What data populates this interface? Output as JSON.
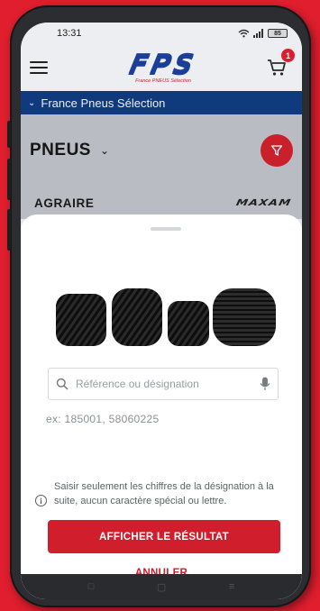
{
  "status_bar": {
    "time": "13:31",
    "battery": "85"
  },
  "header": {
    "logo_text": "FPS",
    "logo_subtitle": "France PNEUS Sélection",
    "cart_count": "1"
  },
  "breadcrumb": {
    "label": "France Pneus Sélection"
  },
  "section": {
    "title": "PNEUS"
  },
  "brand_row": {
    "category": "AGRAIRE",
    "brand_logo": "MAXAM"
  },
  "search_sheet": {
    "search_placeholder": "Référence ou désignation",
    "example": "ex: 185001, 58060225",
    "info_text": "Saisir seulement les chiffres de la désignation à la suite, aucun caractère spécial ou lettre.",
    "submit_label": "AFFICHER LE RÉSULTAT",
    "cancel_label": "ANNULER"
  },
  "icons": {
    "menu": "hamburger-icon",
    "cart": "cart-icon",
    "filter": "funnel-icon",
    "search": "search-icon",
    "mic": "microphone-icon",
    "info": "info-icon"
  },
  "colors": {
    "brand_red": "#d11e2d",
    "brand_blue": "#0f3a7d",
    "logo_blue": "#1b3f99"
  }
}
